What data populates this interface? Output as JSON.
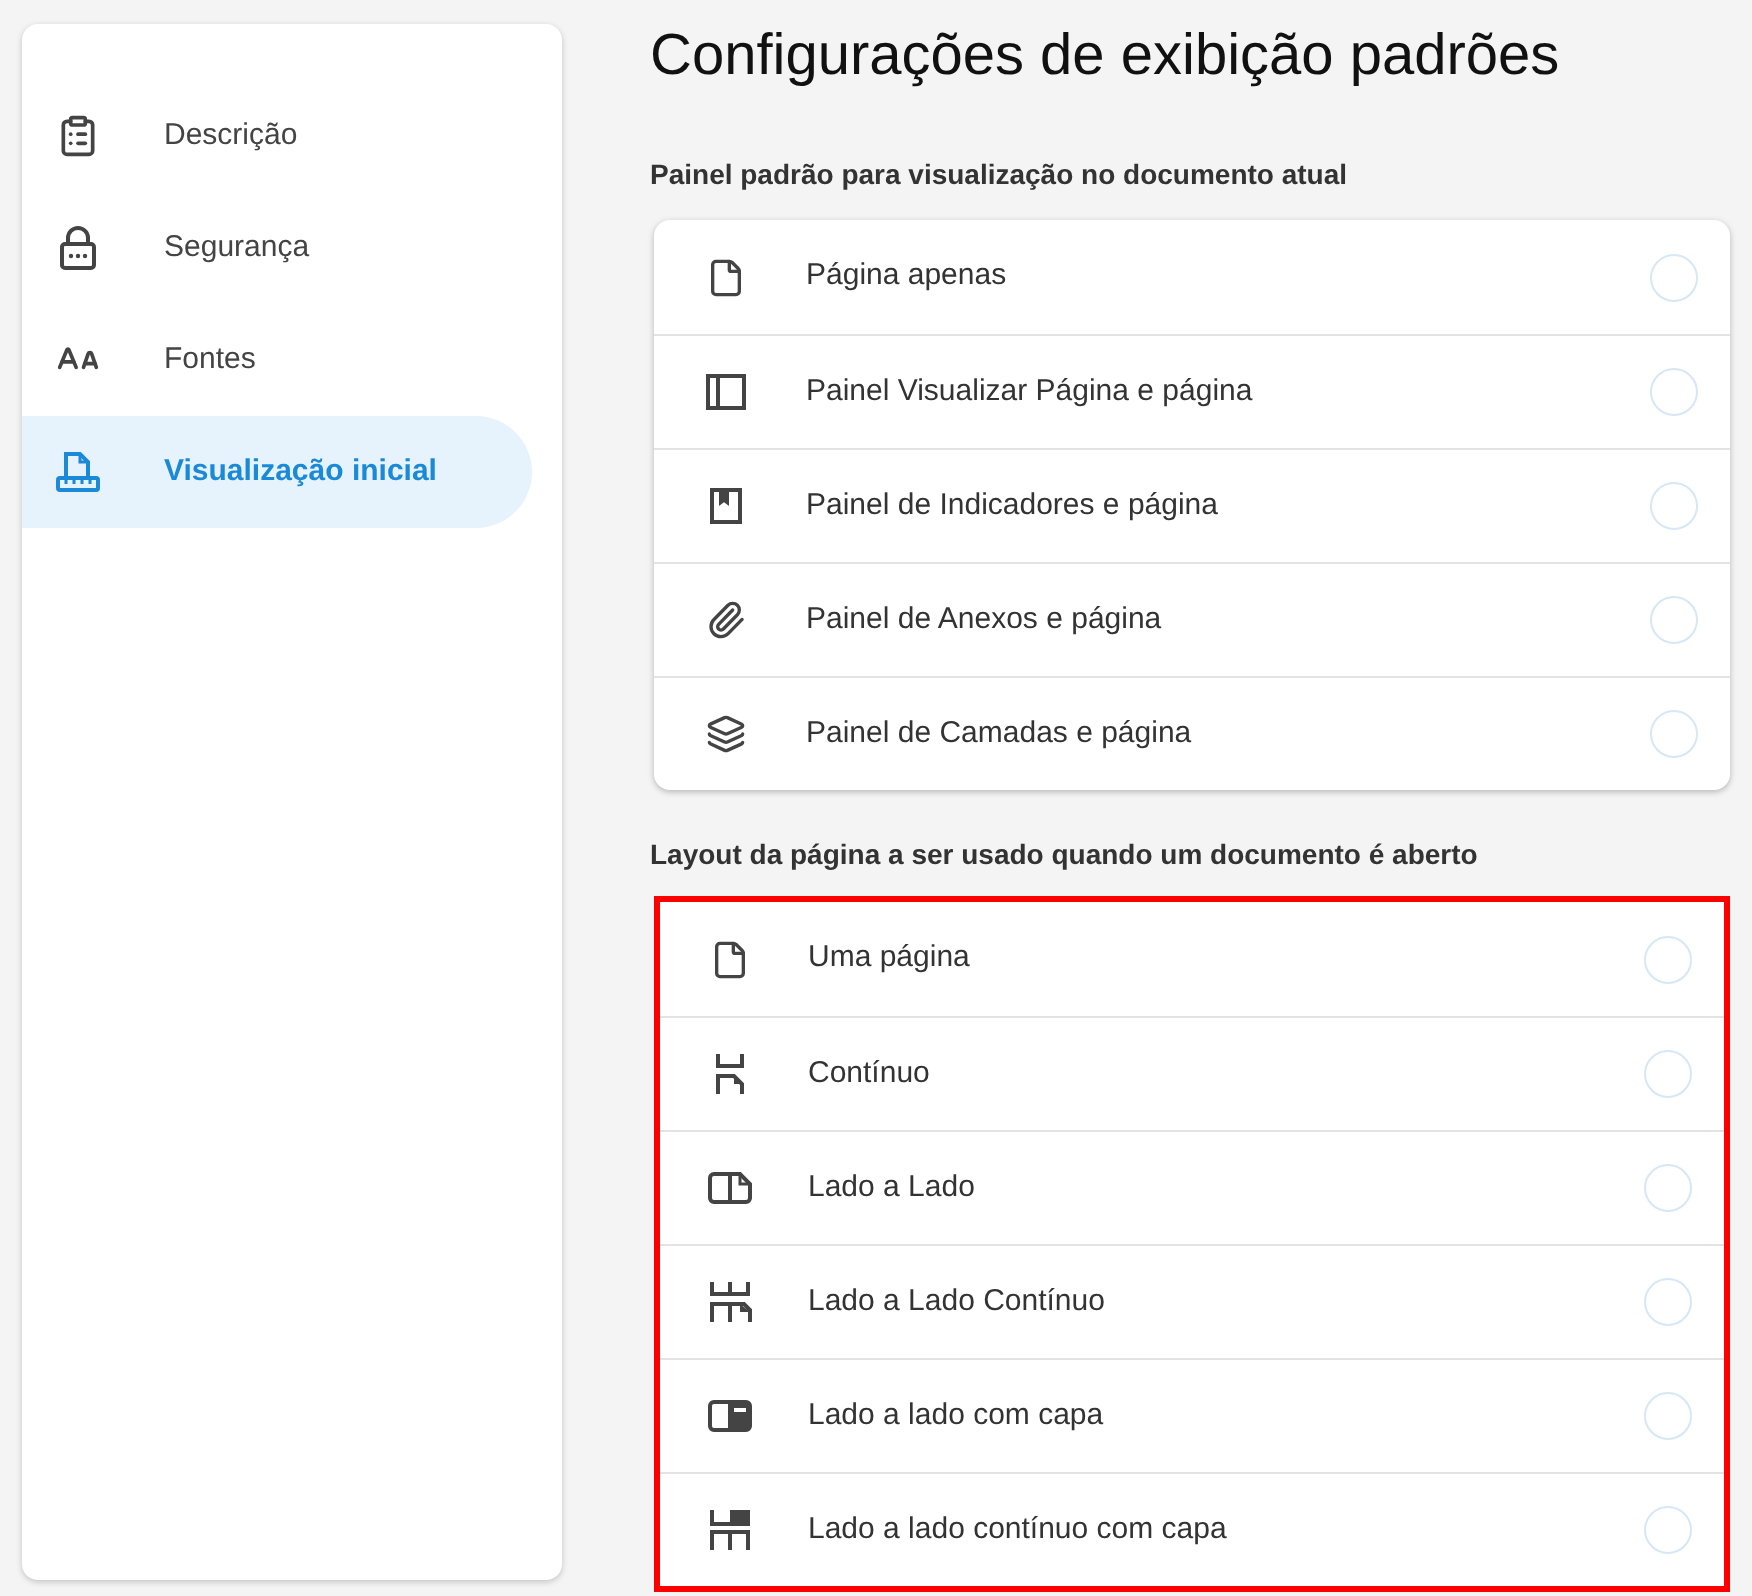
{
  "sidebar": {
    "items": [
      {
        "label": "Descrição",
        "kind": "clipboard",
        "selected": false
      },
      {
        "label": "Segurança",
        "kind": "lock",
        "selected": false
      },
      {
        "label": "Fontes",
        "kind": "fonts",
        "selected": false
      },
      {
        "label": "Visualização inicial",
        "kind": "display",
        "selected": true
      }
    ]
  },
  "title": "Configurações de exibição padrões",
  "sections": [
    {
      "heading": "Painel padrão para visualização no documento atual",
      "highlighted": false,
      "options": [
        {
          "label": "Página apenas",
          "kind": "page",
          "selected": false
        },
        {
          "label": "Painel Visualizar Página e página",
          "kind": "panel",
          "selected": false
        },
        {
          "label": "Painel de Indicadores e página",
          "kind": "bookmark",
          "selected": false
        },
        {
          "label": "Painel de Anexos e página",
          "kind": "attachment",
          "selected": false
        },
        {
          "label": "Painel de Camadas e página",
          "kind": "layers",
          "selected": false
        }
      ]
    },
    {
      "heading": "Layout da página a ser usado quando um documento é aberto",
      "highlighted": true,
      "options": [
        {
          "label": "Uma página",
          "kind": "page",
          "selected": false
        },
        {
          "label": "Contínuo",
          "kind": "continuous",
          "selected": false
        },
        {
          "label": "Lado a Lado",
          "kind": "two-page",
          "selected": false
        },
        {
          "label": "Lado a Lado Contínuo",
          "kind": "two-page-continuous",
          "selected": false
        },
        {
          "label": "Lado a lado com capa",
          "kind": "two-page-cover",
          "selected": false
        },
        {
          "label": "Lado a lado contínuo com capa",
          "kind": "two-page-continuous-cover",
          "selected": false
        }
      ]
    }
  ]
}
